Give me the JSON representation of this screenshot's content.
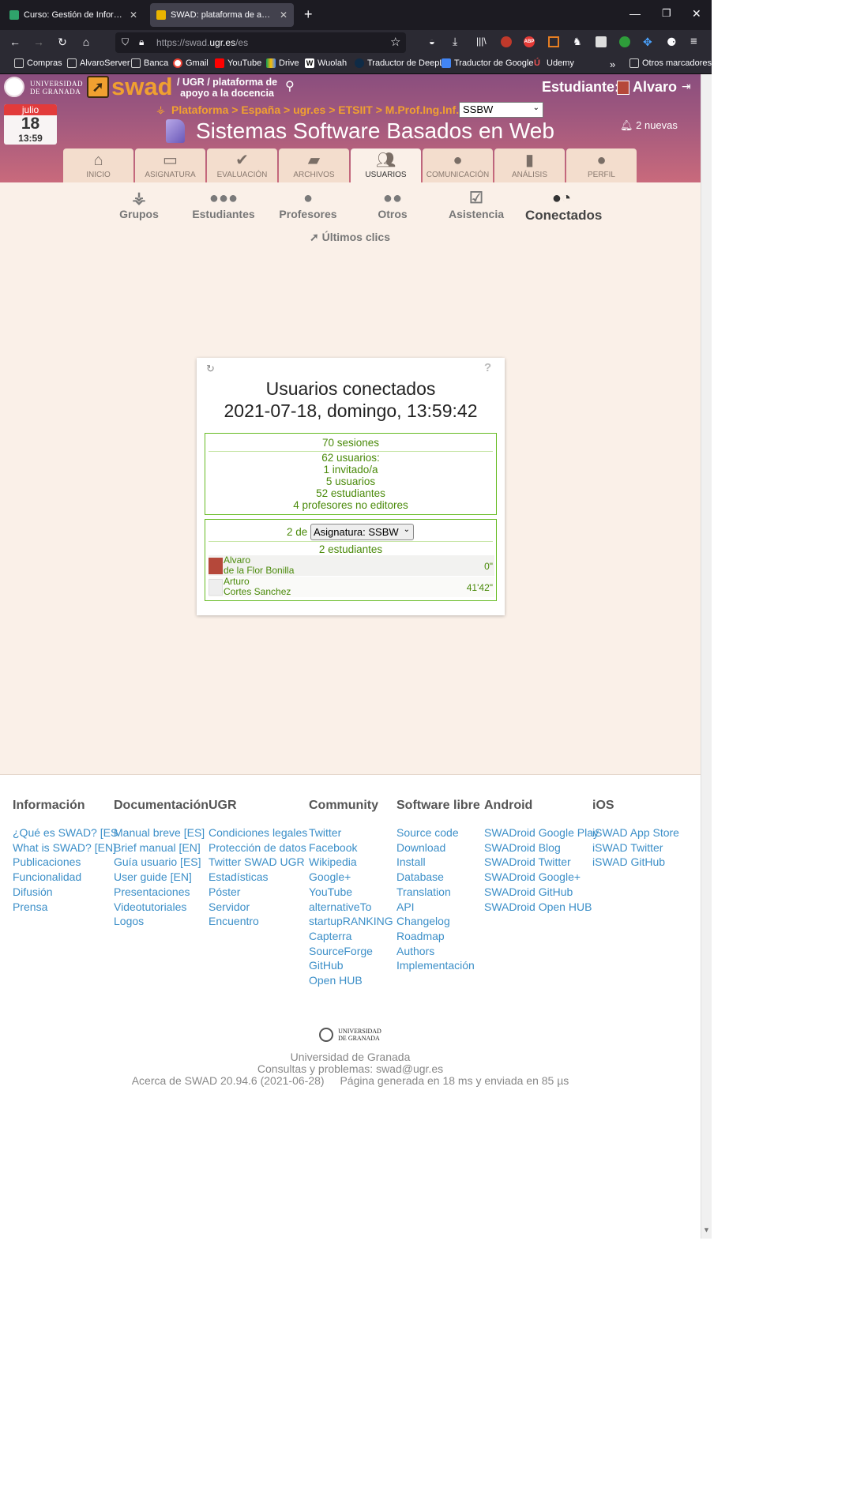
{
  "browser": {
    "tabs": [
      {
        "label": "Curso: Gestión de Información en la Web",
        "active": false
      },
      {
        "label": "SWAD: plataforma de apoyo a la docencia",
        "active": true
      }
    ],
    "url_prefix": "https://swad.",
    "url_host": "ugr.es",
    "url_path": "/es",
    "bookmarks": [
      "Compras",
      "AlvaroServer",
      "Banca",
      "Gmail",
      "YouTube",
      "Drive",
      "Wuolah",
      "Traductor de DeepL",
      "Traductor de Google",
      "Udemy"
    ],
    "other_bookmarks": "Otros marcadores"
  },
  "header": {
    "university_line1": "UNIVERSIDAD",
    "university_line2": "DE GRANADA",
    "logo_text": "swad",
    "tagline_line1": "/ UGR / plataforma de",
    "tagline_line2": "apoyo a la docencia",
    "role_label": "Estudiante:",
    "user_name": "Alvaro",
    "breadcrumb": "Plataforma > España > ugr.es > ETSIIT > M.Prof.Ing.Inf. >",
    "course_select": "SSBW",
    "course_title": "Sistemas Software Basados en Web",
    "notifications": "2 nuevas",
    "date_month": "julio",
    "date_day": "18",
    "date_time": "13:59"
  },
  "main_tabs": [
    {
      "label": "INICIO",
      "icon": "home-icon",
      "glyph": "⌂"
    },
    {
      "label": "ASIGNATURA",
      "icon": "course-icon",
      "glyph": "▭"
    },
    {
      "label": "EVALUACIÓN",
      "icon": "check-icon",
      "glyph": "✔"
    },
    {
      "label": "ARCHIVOS",
      "icon": "folder-icon",
      "glyph": "▰"
    },
    {
      "label": "USUARIOS",
      "icon": "users-icon",
      "glyph": "●●",
      "active": true
    },
    {
      "label": "COMUNICACIÓN",
      "icon": "chat-icon",
      "glyph": "●"
    },
    {
      "label": "ANÁLISIS",
      "icon": "chart-icon",
      "glyph": "▮▮"
    },
    {
      "label": "PERFIL",
      "icon": "profile-icon",
      "glyph": "●"
    }
  ],
  "sub_tabs": [
    {
      "label": "Grupos",
      "icon": "groups-icon"
    },
    {
      "label": "Estudiantes",
      "icon": "students-icon"
    },
    {
      "label": "Profesores",
      "icon": "teachers-icon"
    },
    {
      "label": "Otros",
      "icon": "others-icon"
    },
    {
      "label": "Asistencia",
      "icon": "attendance-icon"
    },
    {
      "label": "Conectados",
      "icon": "connected-icon",
      "active": true
    }
  ],
  "last_clicks": "Últimos clics",
  "connected": {
    "title": "Usuarios conectados",
    "datetime": "2021-07-18, domingo, 13:59:42",
    "sessions": "70 sesiones",
    "users": "62 usuarios:",
    "invited": "1 invitado/a",
    "plain_users": "5 usuarios",
    "students": "52 estudiantes",
    "teachers": "4 profesores no editores",
    "scope_prefix": "2 de",
    "scope_select": "Asignatura: SSBW",
    "course_students": "2 estudiantes",
    "rows": [
      {
        "first": "Alvaro",
        "last": "de la Flor Bonilla",
        "time": "0\""
      },
      {
        "first": "Arturo",
        "last": "Cortes Sanchez",
        "time": "41'42\""
      }
    ]
  },
  "footer": {
    "columns": [
      {
        "title": "Información",
        "links": [
          "¿Qué es SWAD? [ES",
          "What is SWAD? [EN]",
          "Publicaciones",
          "Funcionalidad",
          "Difusión",
          "Prensa"
        ]
      },
      {
        "title": "Documentación",
        "links": [
          "Manual breve [ES]",
          "Brief manual [EN]",
          "Guía usuario [ES]",
          "User guide [EN]",
          "Presentaciones",
          "Videotutoriales",
          "Logos"
        ]
      },
      {
        "title": "UGR",
        "links": [
          "Condiciones legales",
          "Protección de datos",
          "Twitter SWAD UGR",
          "Estadísticas",
          "Póster",
          "Servidor",
          "Encuentro"
        ]
      },
      {
        "title": "Community",
        "links": [
          "Twitter",
          "Facebook",
          "Wikipedia",
          "Google+",
          "YouTube",
          "alternativeTo",
          "startupRANKING",
          "Capterra",
          "SourceForge",
          "GitHub",
          "Open HUB"
        ]
      },
      {
        "title": "Software libre",
        "links": [
          "Source code",
          "Download",
          "Install",
          "Database",
          "Translation",
          "API",
          "Changelog",
          "Roadmap",
          "Authors",
          "Implementación"
        ]
      },
      {
        "title": "Android",
        "links": [
          "SWADroid Google Play",
          "SWADroid Blog",
          "SWADroid Twitter",
          "SWADroid Google+",
          "SWADroid GitHub",
          "SWADroid Open HUB"
        ]
      },
      {
        "title": "iOS",
        "links": [
          "iSWAD App Store",
          "iSWAD Twitter",
          "iSWAD GitHub"
        ]
      }
    ],
    "ugr_line1": "UNIVERSIDAD",
    "ugr_line2": "DE GRANADA",
    "university": "Universidad de Granada",
    "contact": "Consultas y problemas: swad@ugr.es",
    "about": "Acerca de SWAD 20.94.6 (2021-06-28)",
    "generated": "Página generada en 18 ms y enviada en 85 µs"
  },
  "colors": {
    "accent": "#f0a030",
    "link": "#3c8fc8",
    "green": "#4a8a0a"
  }
}
